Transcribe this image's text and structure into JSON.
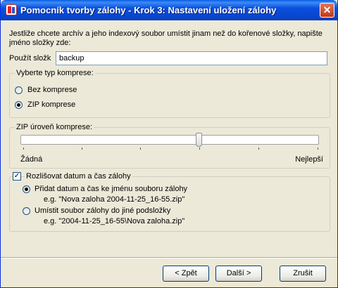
{
  "window": {
    "title": "Pomocník tvorby zálohy - Krok 3: Nastavení uložení zálohy",
    "close": "✕"
  },
  "description": "Jestliže chcete archív a jeho indexový soubor umístit jinam než do kořenové složky, napište jméno složky zde:",
  "folder": {
    "label": "Použít složk",
    "value": "backup"
  },
  "compression_type": {
    "legend": "Vyberte typ komprese:",
    "options": [
      {
        "label": "Bez komprese",
        "selected": false
      },
      {
        "label": "ZIP komprese",
        "selected": true
      }
    ]
  },
  "zip_level": {
    "legend": "ZIP úroveň komprese:",
    "min_label": "Žádná",
    "max_label": "Nejlepší",
    "value_fraction": 0.6
  },
  "datetime": {
    "checkbox_label": "Rozlišovat datum a čas zálohy",
    "checked": true,
    "options": [
      {
        "label": "Přidat datum a čas ke jménu souboru zálohy",
        "example": "e.g. \"Nova zaloha 2004-11-25_16-55.zip\"",
        "selected": true
      },
      {
        "label": "Umístit soubor zálohy do jiné podsložky",
        "example": "e.g. \"2004-11-25_16-55\\Nova zaloha.zip\"",
        "selected": false
      }
    ]
  },
  "buttons": {
    "back": "< Zpět",
    "next": "Další >",
    "cancel": "Zrušit"
  }
}
